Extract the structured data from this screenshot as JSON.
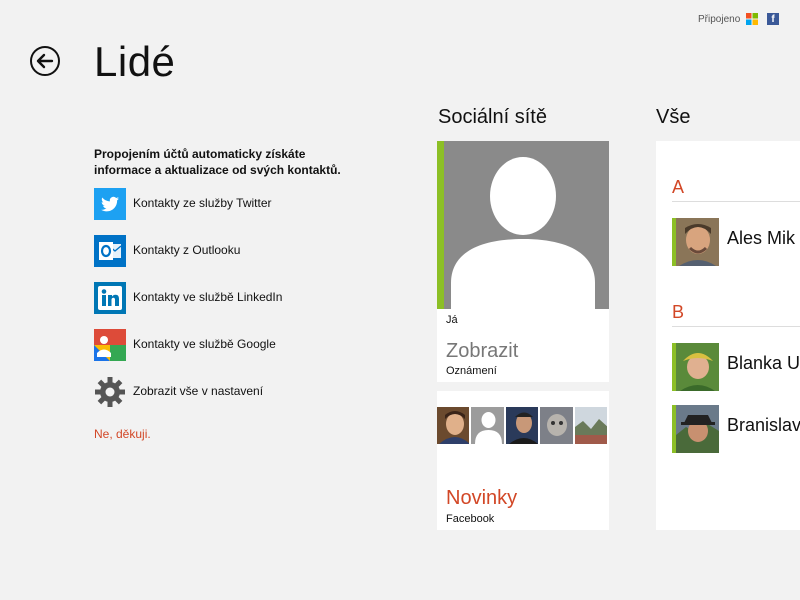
{
  "header": {
    "title": "Lidé",
    "connected_label": "Připojeno"
  },
  "connect": {
    "intro": "Propojením účtů automaticky získáte informace a aktualizace od svých kontaktů.",
    "services": [
      {
        "label": "Kontakty ze služby Twitter",
        "icon": "twitter-icon",
        "color": "#1da1f2"
      },
      {
        "label": "Kontakty z Outlooku",
        "icon": "outlook-icon",
        "color": "#0072c6"
      },
      {
        "label": "Kontakty ve službě LinkedIn",
        "icon": "linkedin-icon",
        "color": "#0077b5"
      },
      {
        "label": "Kontakty ve službě Google",
        "icon": "google-icon",
        "color": "#dd4b39"
      },
      {
        "label": "Zobrazit vše v nastavení",
        "icon": "gear-icon",
        "color": "#555555"
      }
    ],
    "no_thanks": "Ne, děkuji."
  },
  "social": {
    "heading": "Sociální sítě",
    "me": {
      "name": "Já",
      "action": "Zobrazit",
      "sub": "Oznámení"
    },
    "news": {
      "title": "Novinky",
      "sub": "Facebook"
    }
  },
  "all": {
    "heading": "Vše",
    "groups": [
      {
        "letter": "A",
        "contacts": [
          "Ales Mik"
        ]
      },
      {
        "letter": "B",
        "contacts": [
          "Blanka U",
          "Branislav"
        ]
      }
    ]
  },
  "colors": {
    "accent": "#d24726",
    "presence": "#8cbf26",
    "background": "#f2f2f2"
  }
}
